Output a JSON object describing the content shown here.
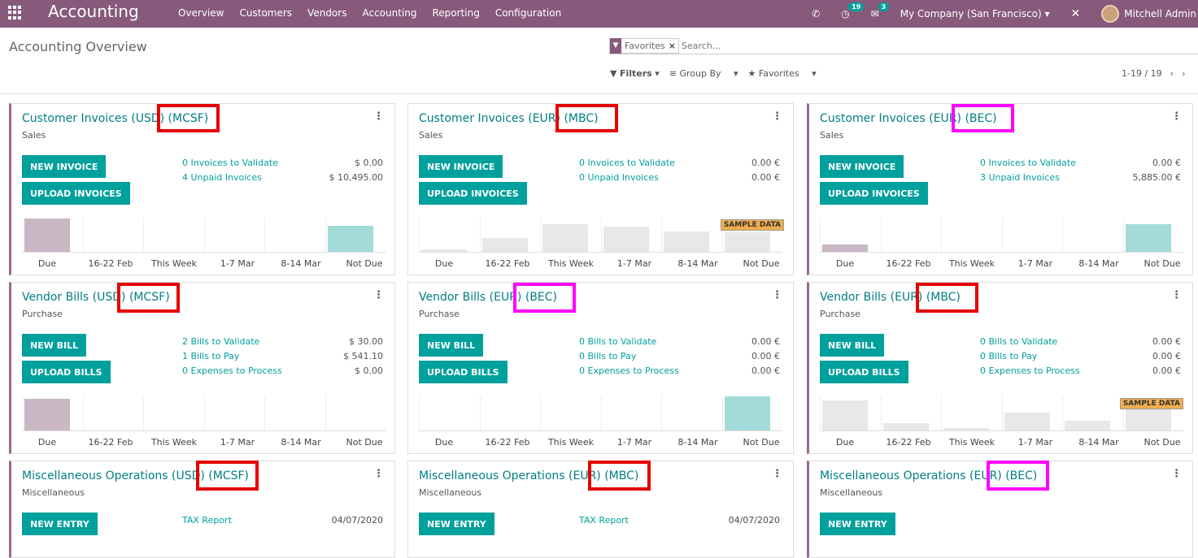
{
  "app": {
    "title": "Accounting"
  },
  "menu": [
    "Overview",
    "Customers",
    "Vendors",
    "Accounting",
    "Reporting",
    "Configuration"
  ],
  "systray": {
    "activity_count": "19",
    "message_count": "3",
    "company": "My Company (San Francisco)",
    "user": "Mitchell Admin"
  },
  "page": {
    "title": "Accounting Overview"
  },
  "search": {
    "facet": "Favorites",
    "placeholder": "Search..."
  },
  "filters": {
    "filters": "Filters",
    "group_by": "Group By",
    "favorites": "Favorites"
  },
  "pager": {
    "text": "1-19 / 19"
  },
  "x_labels": [
    "Due",
    "16-22 Feb",
    "This Week",
    "1-7 Mar",
    "8-14 Mar",
    "Not Due"
  ],
  "sample_label": "SAMPLE DATA",
  "cards": [
    {
      "title": "Customer Invoices (USD) (MCSF)",
      "sub": "Sales",
      "btn1": "NEW INVOICE",
      "btn2": "UPLOAD INVOICES",
      "lines": [
        {
          "l": "0 Invoices to Validate",
          "a": "$ 0.00"
        },
        {
          "l": "4 Unpaid Invoices",
          "a": "$ 10,495.00"
        }
      ],
      "bars": [
        {
          "v": 0.95,
          "c": "#c9b8c4"
        },
        {
          "v": 0,
          "c": "#eee"
        },
        {
          "v": 0,
          "c": "#eee"
        },
        {
          "v": 0,
          "c": "#eee"
        },
        {
          "v": 0,
          "c": "#eee"
        },
        {
          "v": 0.75,
          "c": "#a3dbd9"
        }
      ]
    },
    {
      "title": "Customer Invoices (EUR) (MBC)",
      "sub": "Sales",
      "btn1": "NEW INVOICE",
      "btn2": "UPLOAD INVOICES",
      "lines": [
        {
          "l": "0 Invoices to Validate",
          "a": "0.00 €"
        },
        {
          "l": "0 Unpaid Invoices",
          "a": "0.00 €"
        }
      ],
      "sample": true,
      "bars": [
        {
          "v": 0.07,
          "c": "#e8e8e8"
        },
        {
          "v": 0.4,
          "c": "#e8e8e8"
        },
        {
          "v": 0.8,
          "c": "#e8e8e8"
        },
        {
          "v": 0.72,
          "c": "#e8e8e8"
        },
        {
          "v": 0.58,
          "c": "#e8e8e8"
        },
        {
          "v": 0.55,
          "c": "#e8e8e8"
        }
      ]
    },
    {
      "title": "Customer Invoices (EUR) (BEC)",
      "sub": "Sales",
      "btn1": "NEW INVOICE",
      "btn2": "UPLOAD INVOICES",
      "lines": [
        {
          "l": "0 Invoices to Validate",
          "a": "0.00 €"
        },
        {
          "l": "3 Unpaid Invoices",
          "a": "5,885.00 €"
        }
      ],
      "bars": [
        {
          "v": 0.22,
          "c": "#c9b8c4"
        },
        {
          "v": 0,
          "c": "#eee"
        },
        {
          "v": 0,
          "c": "#eee"
        },
        {
          "v": 0,
          "c": "#eee"
        },
        {
          "v": 0,
          "c": "#eee"
        },
        {
          "v": 0.78,
          "c": "#a3dbd9"
        }
      ]
    },
    {
      "title": "Vendor Bills (USD) (MCSF)",
      "sub": "Purchase",
      "btn1": "NEW BILL",
      "btn2": "UPLOAD BILLS",
      "lines": [
        {
          "l": "2 Bills to Validate",
          "a": "$ 30.00"
        },
        {
          "l": "1 Bills to Pay",
          "a": "$ 541.10"
        },
        {
          "l": "0 Expenses to Process",
          "a": "$ 0.00"
        }
      ],
      "bars": [
        {
          "v": 0.9,
          "c": "#c9b8c4"
        },
        {
          "v": 0,
          "c": "#eee"
        },
        {
          "v": 0,
          "c": "#eee"
        },
        {
          "v": 0,
          "c": "#eee"
        },
        {
          "v": 0,
          "c": "#eee"
        },
        {
          "v": 0,
          "c": "#eee"
        }
      ]
    },
    {
      "title": "Vendor Bills (EUR) (BEC)",
      "sub": "Purchase",
      "btn1": "NEW BILL",
      "btn2": "UPLOAD BILLS",
      "lines": [
        {
          "l": "0 Bills to Validate",
          "a": "0.00 €"
        },
        {
          "l": "0 Bills to Pay",
          "a": "0.00 €"
        },
        {
          "l": "0 Expenses to Process",
          "a": "0.00 €"
        }
      ],
      "bars": [
        {
          "v": 0,
          "c": "#eee"
        },
        {
          "v": 0,
          "c": "#eee"
        },
        {
          "v": 0,
          "c": "#eee"
        },
        {
          "v": 0,
          "c": "#eee"
        },
        {
          "v": 0,
          "c": "#eee"
        },
        {
          "v": 0.98,
          "c": "#a3dbd9"
        }
      ]
    },
    {
      "title": "Vendor Bills (EUR) (MBC)",
      "sub": "Purchase",
      "btn1": "NEW BILL",
      "btn2": "UPLOAD BILLS",
      "lines": [
        {
          "l": "0 Bills to Validate",
          "a": "0.00 €"
        },
        {
          "l": "0 Bills to Pay",
          "a": "0.00 €"
        },
        {
          "l": "0 Expenses to Process",
          "a": "0.00 €"
        }
      ],
      "sample": true,
      "bars": [
        {
          "v": 0.85,
          "c": "#e8e8e8"
        },
        {
          "v": 0.2,
          "c": "#e8e8e8"
        },
        {
          "v": 0.07,
          "c": "#e8e8e8"
        },
        {
          "v": 0.52,
          "c": "#e8e8e8"
        },
        {
          "v": 0.27,
          "c": "#e8e8e8"
        },
        {
          "v": 0.6,
          "c": "#e8e8e8"
        }
      ]
    },
    {
      "title": "Miscellaneous Operations (USD) (MCSF)",
      "sub": "Miscellaneous",
      "btn1": "NEW ENTRY",
      "tax": "TAX Report",
      "date": "04/07/2020"
    },
    {
      "title": "Miscellaneous Operations (EUR) (MBC)",
      "sub": "Miscellaneous",
      "btn1": "NEW ENTRY",
      "tax": "TAX Report",
      "date": "04/07/2020"
    },
    {
      "title": "Miscellaneous Operations (EUR) (BEC)",
      "sub": "Miscellaneous",
      "btn1": "NEW ENTRY"
    }
  ],
  "colors": {
    "topbar": "#875a7b",
    "accent": "#00a09d",
    "title": "#017e84",
    "red_highlight": "#e60000",
    "magenta_highlight": "#ff00ff"
  }
}
